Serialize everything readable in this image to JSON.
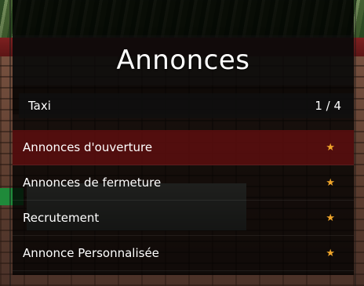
{
  "menu": {
    "title": "Annonces",
    "category": "Taxi",
    "counter": "1 / 4",
    "items": [
      {
        "label": "Annonces d'ouverture",
        "icon": "star-icon",
        "selected": true
      },
      {
        "label": "Annonces de fermeture",
        "icon": "star-icon",
        "selected": false
      },
      {
        "label": "Recrutement",
        "icon": "star-icon",
        "selected": false
      },
      {
        "label": "Annonce Personnalisée",
        "icon": "star-icon",
        "selected": false
      }
    ]
  },
  "colors": {
    "selected_row": "#5f0f0f",
    "star": "#f0a52a",
    "text": "#ffffff"
  }
}
